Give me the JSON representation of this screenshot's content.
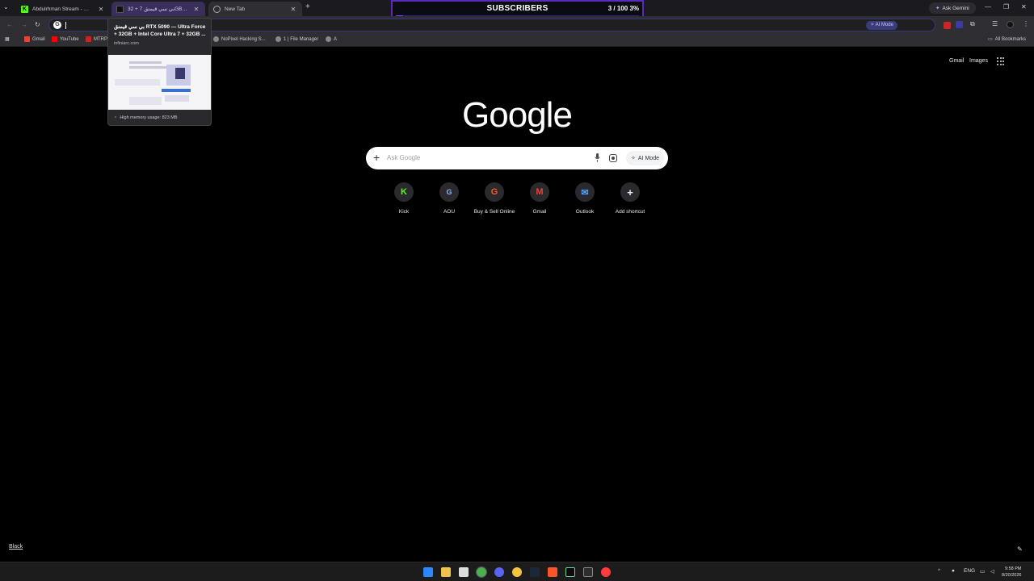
{
  "tabs": [
    {
      "title": "Abdulrhman Stream - Watch Live",
      "favicon": "kick-icon"
    },
    {
      "title": "بي سي قيمنق 7 + 32GB DDR5 ...",
      "favicon": "site-icon",
      "active_hover": true
    },
    {
      "title": "New Tab",
      "favicon": "globe-icon"
    }
  ],
  "ask_gemini": "Ask Gemini",
  "subscribers": {
    "title": "SUBSCRIBERS",
    "count": "3 / 100",
    "percent": "3%",
    "progress": 0.03
  },
  "omnibox": {
    "value": "",
    "ai_mode": "AI Mode"
  },
  "bookmarks": [
    {
      "label": "Gmail",
      "color": "#ea4335"
    },
    {
      "label": "YouTube",
      "color": "#ff0000"
    },
    {
      "label": "MTRP",
      "color": "#cc2222"
    },
    {
      "label": "NoPixel Hacking S...",
      "color": "#888888"
    },
    {
      "label": "1 | File Manager",
      "color": "#888888"
    },
    {
      "label": "A",
      "color": "#888888"
    }
  ],
  "all_bookmarks": "All Bookmarks",
  "hover_card": {
    "title": "بي سي قيمنق RTX 5090 — Ultra Force + 32GB + Intel Core Ultra 7 + 32GB ...",
    "domain": "infiniarc.com",
    "memory": "High memory usage: 823 MB"
  },
  "google": {
    "gmail": "Gmail",
    "images": "Images",
    "logo": "Google",
    "placeholder": "Ask Google",
    "ai_mode": "AI Mode"
  },
  "shortcuts": [
    {
      "label": "Kick",
      "glyph": "K",
      "color": "#53fc18"
    },
    {
      "label": "AOU",
      "glyph": "G",
      "color": "#8ab4f8"
    },
    {
      "label": "Buy & Sell Online",
      "glyph": "G",
      "color": "#ff5722"
    },
    {
      "label": "Gmail",
      "glyph": "M",
      "color": "#ea4335"
    },
    {
      "label": "Outlook",
      "glyph": "✉",
      "color": "#4fa3ff"
    },
    {
      "label": "Add shortcut",
      "glyph": "+",
      "color": "#e8eaed"
    }
  ],
  "theme_label": "Black",
  "taskbar": {
    "lang": "ENG",
    "time": "9:58 PM",
    "date": "8/20/2026"
  }
}
